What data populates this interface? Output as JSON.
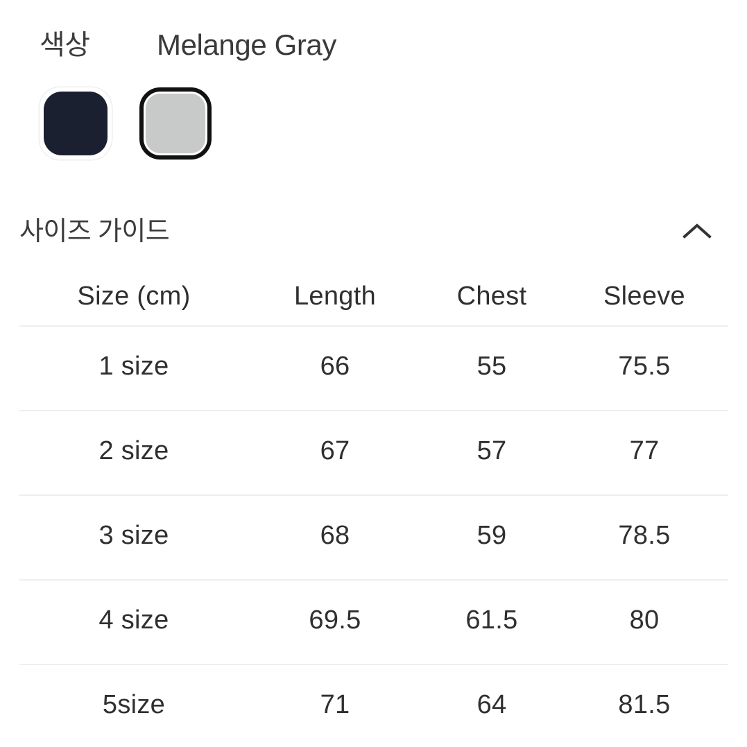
{
  "color_section": {
    "label": "색상",
    "selected_value": "Melange Gray",
    "swatches": [
      {
        "name": "navy",
        "hex": "#1b2030",
        "selected": false
      },
      {
        "name": "melange-gray",
        "hex": "#c8c9c9",
        "selected": true
      }
    ]
  },
  "size_guide": {
    "title": "사이즈 가이드",
    "toggle_icon": "chevron-up-icon",
    "expanded": true,
    "table": {
      "columns": [
        "Size (cm)",
        "Length",
        "Chest",
        "Sleeve"
      ],
      "rows": [
        {
          "size": "1 size",
          "length": "66",
          "chest": "55",
          "sleeve": "75.5"
        },
        {
          "size": "2 size",
          "length": "67",
          "chest": "57",
          "sleeve": "77"
        },
        {
          "size": "3 size",
          "length": "68",
          "chest": "59",
          "sleeve": "78.5"
        },
        {
          "size": "4 size",
          "length": "69.5",
          "chest": "61.5",
          "sleeve": "80"
        },
        {
          "size": "5size",
          "length": "71",
          "chest": "64",
          "sleeve": "81.5"
        }
      ]
    }
  },
  "colors": {
    "background": "#ffffff",
    "text": "#3a3a3a",
    "divider": "#eeeeee",
    "selected_ring": "#111111",
    "unselected_ring": "#ffffff"
  }
}
